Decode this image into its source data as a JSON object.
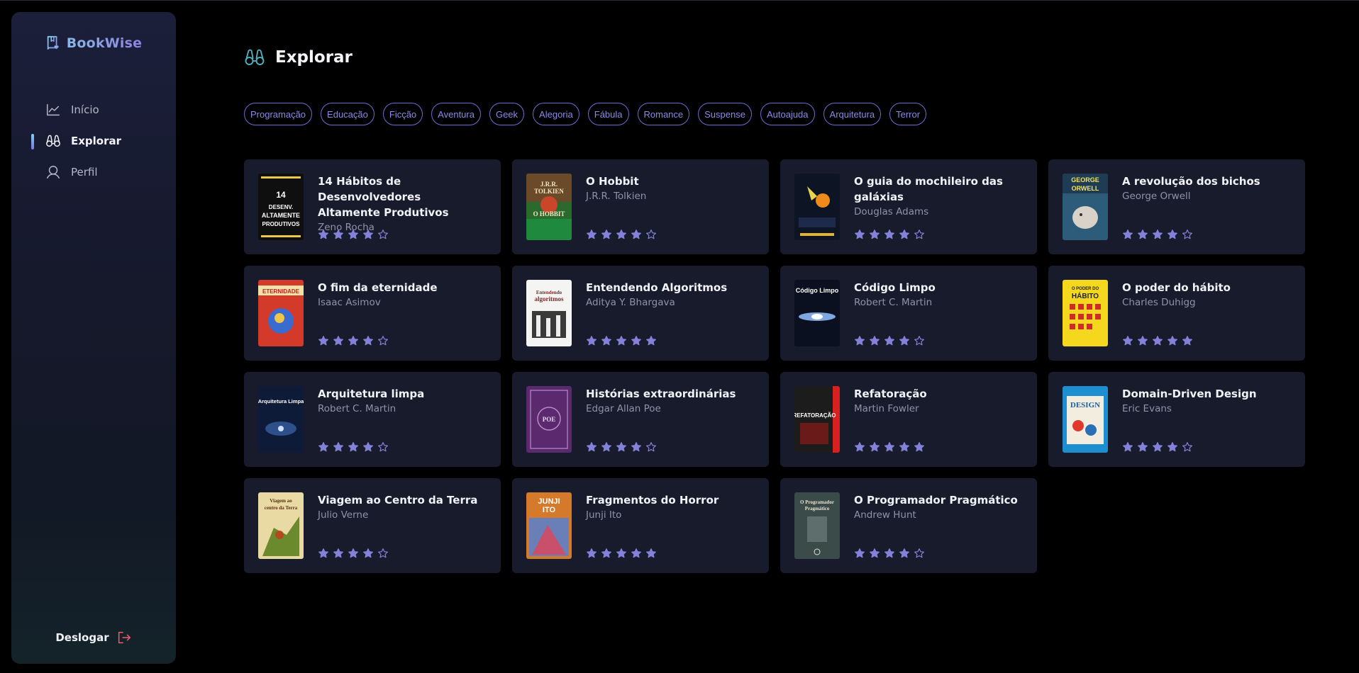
{
  "brand": {
    "name": "BookWise"
  },
  "nav": [
    {
      "label": "Início",
      "icon": "chart-line-icon",
      "active": false
    },
    {
      "label": "Explorar",
      "icon": "binoculars-icon",
      "active": true
    },
    {
      "label": "Perfil",
      "icon": "user-icon",
      "active": false
    }
  ],
  "logout": {
    "label": "Deslogar",
    "icon": "sign-out-icon"
  },
  "page": {
    "title": "Explorar",
    "icon": "binoculars-icon"
  },
  "tags": [
    "Programação",
    "Educação",
    "Ficção",
    "Aventura",
    "Geek",
    "Alegoria",
    "Fábula",
    "Romance",
    "Suspense",
    "Autoajuda",
    "Arquitetura",
    "Terror"
  ],
  "colors": {
    "accent": "#8381d9",
    "card_bg": "#181c2a",
    "star": "#8381d9",
    "logout_icon": "#f75a68"
  },
  "books": [
    {
      "title": "14 Hábitos de Desenvolvedores Altamente Produtivos",
      "author": "Zeno Rocha",
      "rating": 4
    },
    {
      "title": "O Hobbit",
      "author": "J.R.R. Tolkien",
      "rating": 4
    },
    {
      "title": "O guia do mochileiro das galáxias",
      "author": "Douglas Adams",
      "rating": 4
    },
    {
      "title": "A revolução dos bichos",
      "author": "George Orwell",
      "rating": 4
    },
    {
      "title": "O fim da eternidade",
      "author": "Isaac Asimov",
      "rating": 4
    },
    {
      "title": "Entendendo Algoritmos",
      "author": "Aditya Y. Bhargava",
      "rating": 5
    },
    {
      "title": "Código Limpo",
      "author": "Robert C. Martin",
      "rating": 4
    },
    {
      "title": "O poder do hábito",
      "author": "Charles Duhigg",
      "rating": 5
    },
    {
      "title": "Arquitetura limpa",
      "author": "Robert C. Martin",
      "rating": 4
    },
    {
      "title": "Histórias extraordinárias",
      "author": "Edgar Allan Poe",
      "rating": 4
    },
    {
      "title": "Refatoração",
      "author": "Martin Fowler",
      "rating": 5
    },
    {
      "title": "Domain-Driven Design",
      "author": "Eric Evans",
      "rating": 4
    },
    {
      "title": "Viagem ao Centro da Terra",
      "author": "Julio Verne",
      "rating": 4
    },
    {
      "title": "Fragmentos do Horror",
      "author": "Junji Ito",
      "rating": 5
    },
    {
      "title": "O Programador Pragmático",
      "author": "Andrew Hunt",
      "rating": 4
    }
  ]
}
